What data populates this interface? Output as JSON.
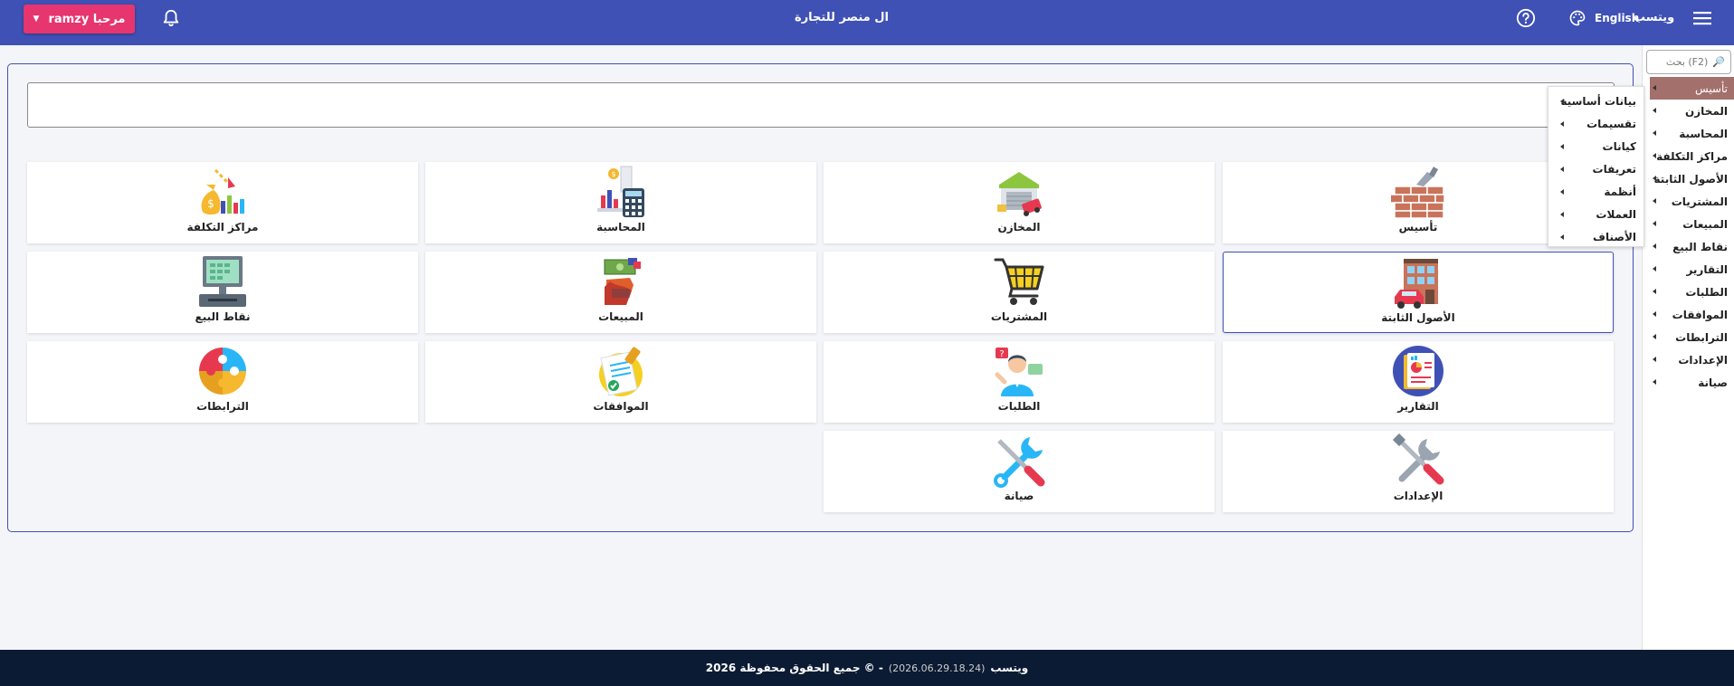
{
  "topbar": {
    "title": "ال منصر للتجارة",
    "brand": "ويتسب",
    "language": "English",
    "greeting": "مرحبا ramzy",
    "icons": [
      "menu-icon",
      "palette-icon",
      "help-icon",
      "bell-icon",
      "caret-down-icon"
    ]
  },
  "sidebar": {
    "search_placeholder": "بحث (F2)",
    "items": [
      {
        "label": "تأسيس",
        "active": true
      },
      {
        "label": "المخازن"
      },
      {
        "label": "المحاسبة"
      },
      {
        "label": "مراكز التكلفة"
      },
      {
        "label": "الأصول الثابتة"
      },
      {
        "label": "المشتريات"
      },
      {
        "label": "المبيعات"
      },
      {
        "label": "نقاط البيع"
      },
      {
        "label": "التقارير"
      },
      {
        "label": "الطلبات"
      },
      {
        "label": "الموافقات"
      },
      {
        "label": "الترابطات"
      },
      {
        "label": "الإعدادات"
      },
      {
        "label": "صيانة"
      }
    ]
  },
  "flyout": {
    "items": [
      "بيانات أساسية",
      "تقسيمات",
      "كيانات",
      "تعريفات",
      "أنظمة",
      "العملات",
      "الأصناف"
    ]
  },
  "tiles": {
    "setup": "تأسيس",
    "warehouses": "المخازن",
    "accounting": "المحاسبة",
    "cost_centers": "مراكز التكلفة",
    "fixed_assets": "الأصول الثابتة",
    "purchases": "المشتريات",
    "sales": "المبيعات",
    "pos": "نقاط البيع",
    "reports": "التقارير",
    "requests": "الطلبات",
    "approvals": "الموافقات",
    "integrations": "الترابطات",
    "settings": "الإعدادات",
    "maintenance": "صيانة"
  },
  "footer": {
    "brand": "ويتسب",
    "version": "(2026.06.29.18.24)",
    "copyright": "- © جميع الحقوق محفوظة 2026"
  },
  "colors": {
    "primary": "#3f51b5",
    "accent": "#e6356f",
    "sidebar_active": "#a3706c",
    "footer": "#0b1b33"
  }
}
